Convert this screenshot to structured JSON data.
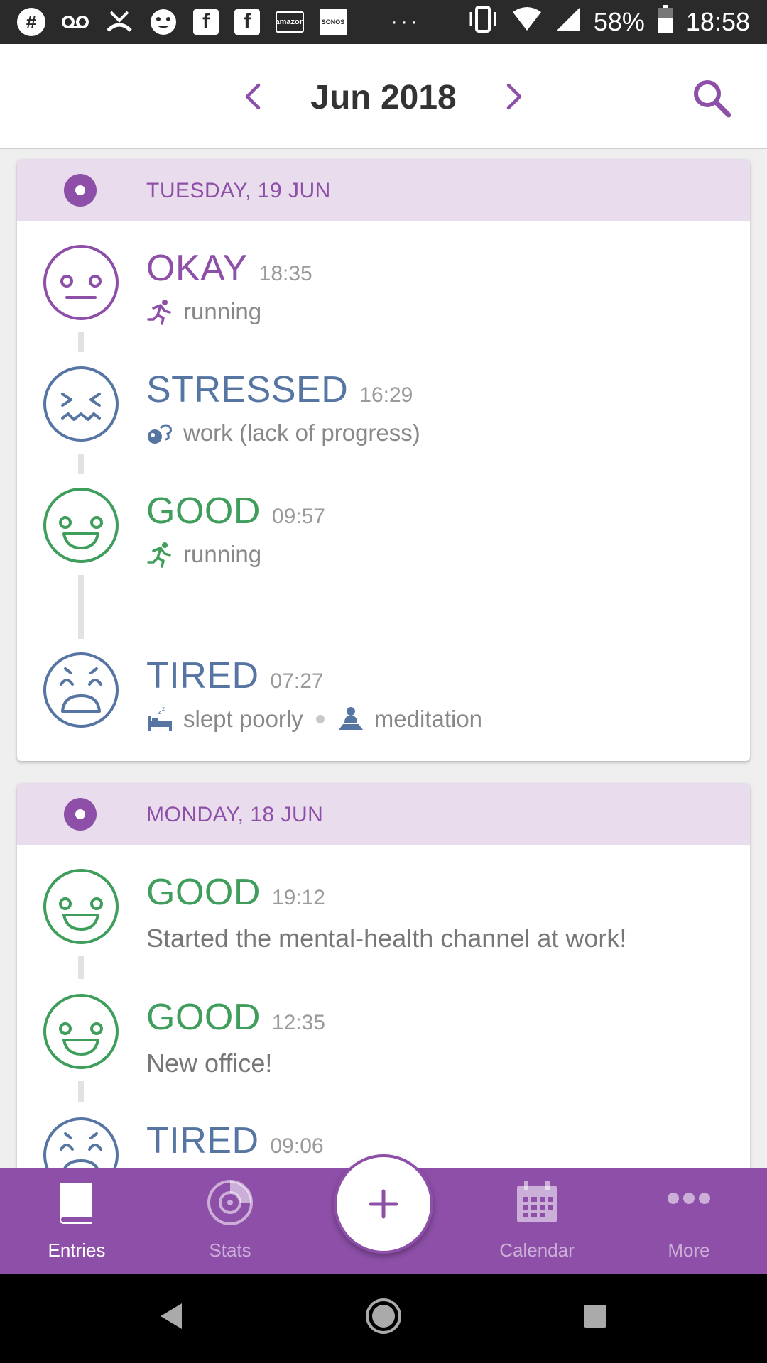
{
  "status_bar": {
    "icons": [
      "slack-icon",
      "voicemail-icon",
      "missed-call-icon",
      "face-icon",
      "facebook-icon",
      "facebook-icon",
      "amazon-icon",
      "sonos-icon",
      "more-dots-icon"
    ],
    "amazon_label": "amazon",
    "sonos_label": "SONOS",
    "battery": "58%",
    "time": "18:58"
  },
  "header": {
    "month": "Jun 2018"
  },
  "days": [
    {
      "date": "TUESDAY, 19 JUN",
      "entries": [
        {
          "mood": "OKAY",
          "time": "18:35",
          "color": "#8d4fa8",
          "face": "neutral",
          "activities": [
            {
              "icon": "running-icon",
              "label": "running"
            }
          ]
        },
        {
          "mood": "STRESSED",
          "time": "16:29",
          "color": "#5675a3",
          "face": "stressed",
          "activities": [
            {
              "icon": "work-icon",
              "label": "work (lack of progress)"
            }
          ]
        },
        {
          "mood": "GOOD",
          "time": "09:57",
          "color": "#3f9e5b",
          "face": "happy",
          "activities": [
            {
              "icon": "running-icon",
              "label": "running"
            }
          ]
        },
        {
          "mood": "TIRED",
          "time": "07:27",
          "color": "#5675a3",
          "face": "tired",
          "activities": [
            {
              "icon": "bed-icon",
              "label": "slept poorly"
            },
            {
              "icon": "meditation-icon",
              "label": "meditation"
            }
          ]
        }
      ]
    },
    {
      "date": "MONDAY, 18 JUN",
      "entries": [
        {
          "mood": "GOOD",
          "time": "19:12",
          "color": "#3f9e5b",
          "face": "happy",
          "note": "Started the mental-health channel at work!"
        },
        {
          "mood": "GOOD",
          "time": "12:35",
          "color": "#3f9e5b",
          "face": "happy",
          "note": "New office!"
        },
        {
          "mood": "TIRED",
          "time": "09:06",
          "color": "#5675a3",
          "face": "tired"
        }
      ]
    }
  ],
  "bottom_nav": {
    "items": [
      {
        "label": "Entries",
        "icon": "book-icon",
        "active": true
      },
      {
        "label": "Stats",
        "icon": "pie-chart-icon",
        "active": false
      },
      {
        "label": "Calendar",
        "icon": "calendar-icon",
        "active": false
      },
      {
        "label": "More",
        "icon": "more-icon",
        "active": false
      }
    ],
    "fab_icon": "plus-icon"
  },
  "colors": {
    "accent": "#8d4fa8",
    "okay": "#8d4fa8",
    "stressed_tired": "#5675a3",
    "good": "#3f9e5b",
    "day_header_bg": "#e9dcec"
  }
}
